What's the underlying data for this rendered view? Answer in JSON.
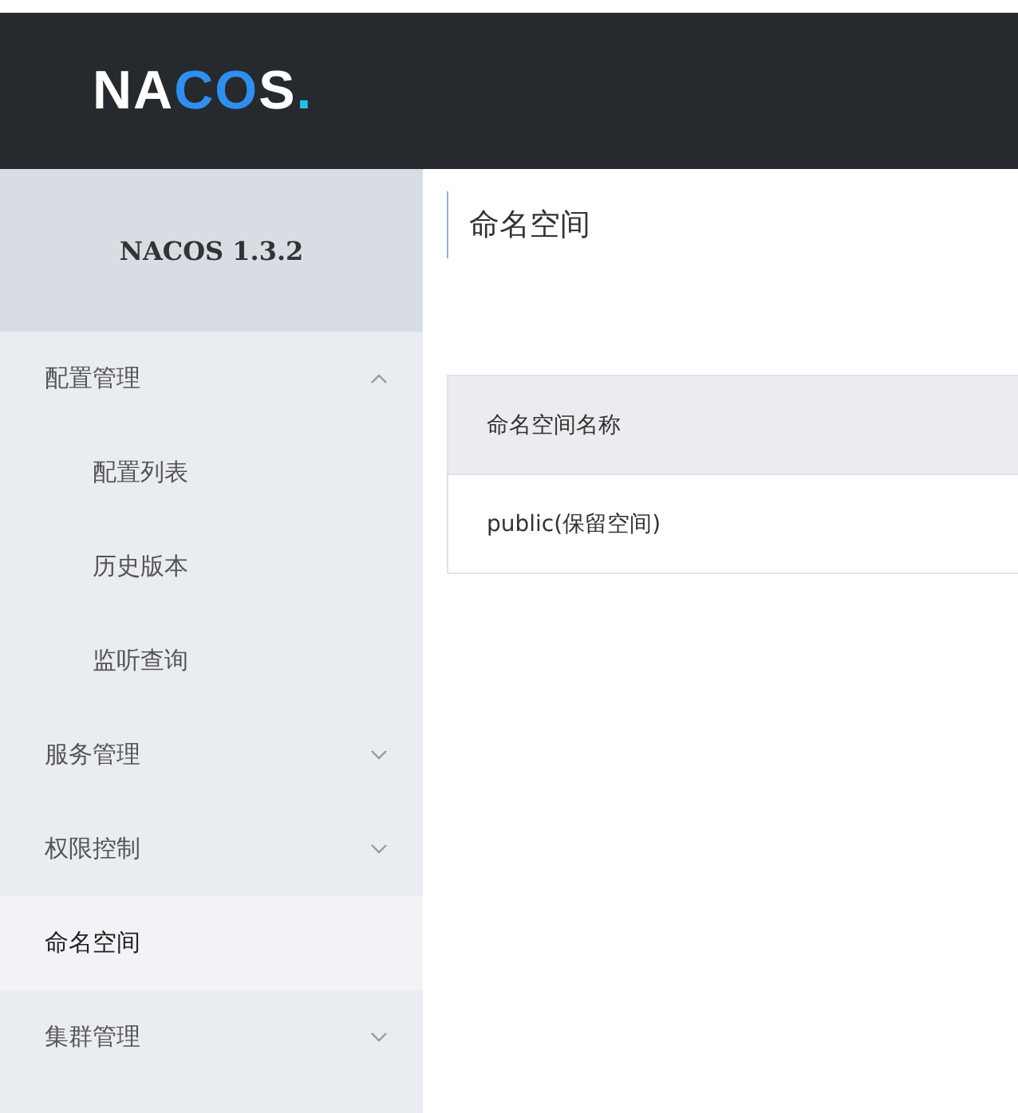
{
  "header": {
    "logo": [
      {
        "text": "NA",
        "color": "#ffffff"
      },
      {
        "text": "CO",
        "color": "#2f8ff0"
      },
      {
        "text": "S",
        "color": "#ffffff"
      },
      {
        "text": ".",
        "color": "#1fc3e8"
      }
    ]
  },
  "sidebar": {
    "version": "NACOS 1.3.2",
    "items": [
      {
        "label": "配置管理",
        "expanded": true,
        "selected": false,
        "children": [
          {
            "label": "配置列表",
            "selected": false
          },
          {
            "label": "历史版本",
            "selected": false
          },
          {
            "label": "监听查询",
            "selected": false
          }
        ]
      },
      {
        "label": "服务管理",
        "expanded": false,
        "selected": false
      },
      {
        "label": "权限控制",
        "expanded": false,
        "selected": false
      },
      {
        "label": "命名空间",
        "selected": true
      },
      {
        "label": "集群管理",
        "expanded": false,
        "selected": false
      }
    ]
  },
  "content": {
    "title": "命名空间",
    "table": {
      "columns": [
        "命名空间名称"
      ],
      "rows": [
        [
          "public(保留空间)"
        ]
      ]
    }
  }
}
